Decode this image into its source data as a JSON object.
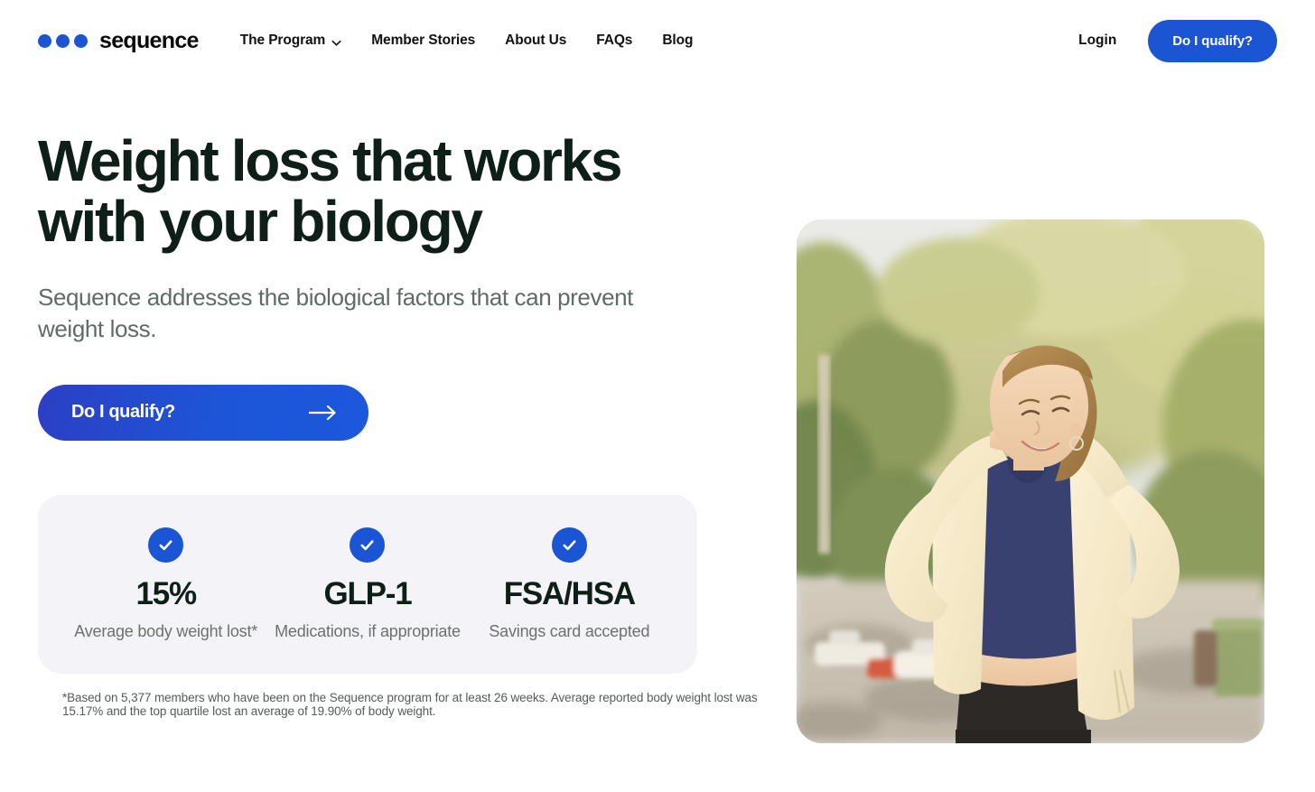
{
  "brand": {
    "name": "sequence",
    "dot_color": "#1B55D4"
  },
  "header": {
    "nav": [
      {
        "label": "The Program",
        "has_dropdown": true
      },
      {
        "label": "Member Stories",
        "has_dropdown": false
      },
      {
        "label": "About Us",
        "has_dropdown": false
      },
      {
        "label": "FAQs",
        "has_dropdown": false
      },
      {
        "label": "Blog",
        "has_dropdown": false
      }
    ],
    "login_label": "Login",
    "cta_label": "Do I qualify?"
  },
  "hero": {
    "headline_line1": "Weight loss that works",
    "headline_line2": "with your biology",
    "subhead": "Sequence addresses the biological factors that can prevent weight loss.",
    "cta_label": "Do I qualify?",
    "cta_icon": "arrow-right-icon",
    "image_alt": "Smiling woman outdoors with hands behind her head, wearing a navy crop top and cream cardigan on a tree-lined street"
  },
  "stats": [
    {
      "icon": "check-circle-icon",
      "value": "15%",
      "label": "Average body weight lost*"
    },
    {
      "icon": "check-circle-icon",
      "value": "GLP-1",
      "label": "Medications, if appropriate"
    },
    {
      "icon": "check-circle-icon",
      "value": "FSA/HSA",
      "label": "Savings card accepted"
    }
  ],
  "footnote": "*Based on 5,377 members who have been on the Sequence program for at least 26 weeks. Average reported body weight lost was 15.17% and the top quartile lost an average of 19.90% of body weight.",
  "colors": {
    "accent_blue": "#1B55D4",
    "headline": "#0E1F18",
    "body_text": "#5E6B66",
    "card_bg": "#F4F4F8"
  }
}
